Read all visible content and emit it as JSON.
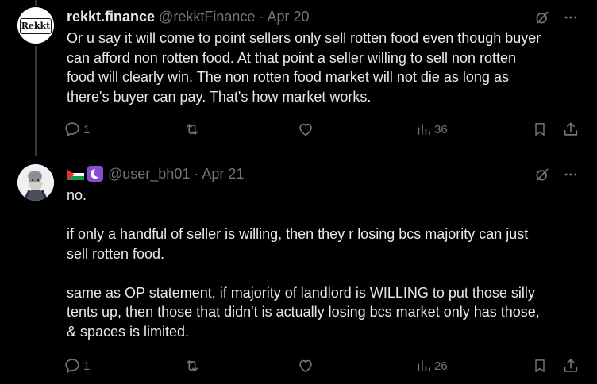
{
  "tweets": [
    {
      "display_name": "rekkt.finance",
      "handle": "@rekktFinance",
      "separator": "·",
      "date": "Apr 20",
      "avatar_text": "Rekkt",
      "text": "Or u say it will come to point sellers only sell rotten food even though buyer\ncan afford non rotten food. At that point a seller willing to sell non rotten\nfood will clearly win. The non rotten food market will not die as long as\nthere's buyer can pay. That's how market works.",
      "replies": "1",
      "views": "36"
    },
    {
      "display_name_icons": [
        "palestine-flag-icon",
        "crescent-badge-icon"
      ],
      "handle": "@user_bh01",
      "separator": "·",
      "date": "Apr 21",
      "text": "no.\n\nif only a handful of seller is willing, then they r losing bcs majority can just\nsell rotten food.\n\nsame as OP statement, if majority of landlord is WILLING to put those silly\ntents up, then those that didn't is actually losing bcs market only has those,\n& spaces is limited.",
      "replies": "1",
      "views": "26"
    }
  ],
  "colors": {
    "background": "#000000",
    "text": "#e7e9ea",
    "muted": "#71767b",
    "thread_line": "#333639",
    "badge_purple": "#8a4bd8"
  }
}
